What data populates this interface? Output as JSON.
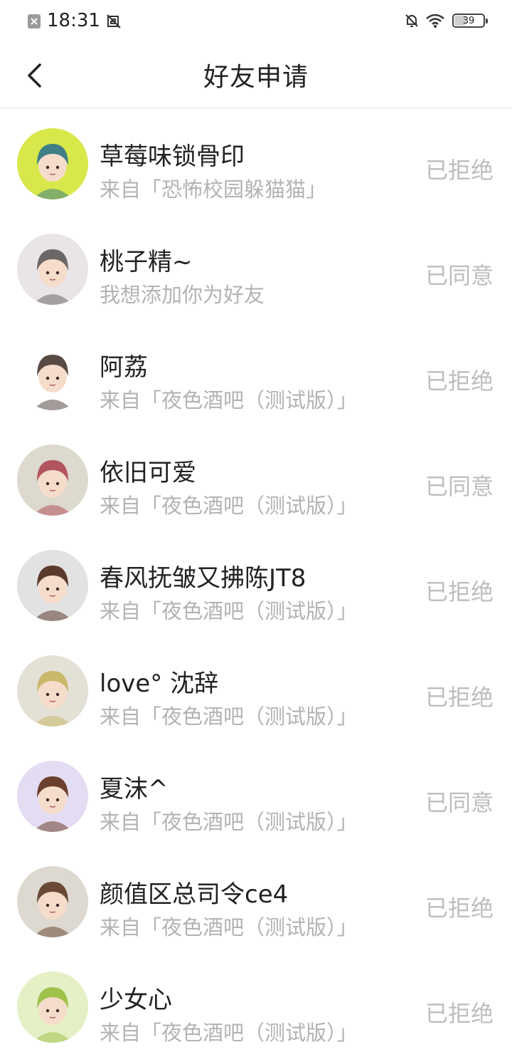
{
  "status_bar": {
    "time": "18:31",
    "battery": "39",
    "battery_level": 0.39
  },
  "header": {
    "title": "好友申请",
    "back_icon": "chevron-left-icon"
  },
  "requests": [
    {
      "name": "草莓味锁骨印",
      "subtitle": "来自「恐怖校园躲猫猫」",
      "status": "已拒绝",
      "avatar_bg": "#d8e84a"
    },
    {
      "name": "桃子精~",
      "subtitle": "我想添加你为好友",
      "status": "已同意",
      "avatar_bg": "#e8e4e8"
    },
    {
      "name": "阿荔",
      "subtitle": "来自「夜色酒吧（测试版）」",
      "status": "已拒绝",
      "avatar_bg": "#ffffff"
    },
    {
      "name": "依旧可爱",
      "subtitle": "来自「夜色酒吧（测试版）」",
      "status": "已同意",
      "avatar_bg": "#ddd9cf"
    },
    {
      "name": "春风抚皱又拂陈JT8",
      "subtitle": "来自「夜色酒吧（测试版）」",
      "status": "已拒绝",
      "avatar_bg": "#e2e2e2"
    },
    {
      "name": "love° 沈辞",
      "subtitle": "来自「夜色酒吧（测试版）」",
      "status": "已拒绝",
      "avatar_bg": "#e3e0d6"
    },
    {
      "name": "夏沫^",
      "subtitle": "来自「夜色酒吧（测试版）」",
      "status": "已同意",
      "avatar_bg": "#e4dcf2"
    },
    {
      "name": "颜值区总司令ce4",
      "subtitle": "来自「夜色酒吧（测试版）」",
      "status": "已拒绝",
      "avatar_bg": "#ddd9d0"
    },
    {
      "name": "少女心",
      "subtitle": "来自「夜色酒吧（测试版）」",
      "status": "已拒绝",
      "avatar_bg": "#e6f0c6"
    }
  ]
}
